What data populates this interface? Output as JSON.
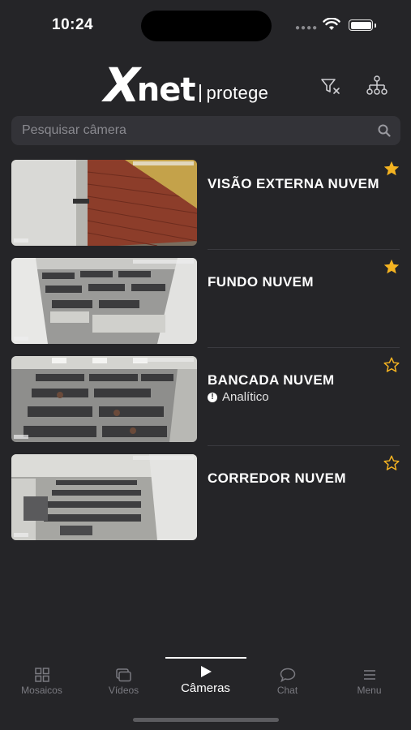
{
  "status_bar": {
    "time": "10:24"
  },
  "header": {
    "logo_x": "X",
    "logo_net": "net",
    "logo_tagline": "protege",
    "filter_icon": "filter-clear-icon",
    "tree_icon": "network-tree-icon"
  },
  "search": {
    "placeholder": "Pesquisar câmera",
    "value": ""
  },
  "cameras": [
    {
      "name": "VISÃO EXTERNA NUVEM",
      "favorite": true,
      "badge": ""
    },
    {
      "name": "FUNDO NUVEM",
      "favorite": true,
      "badge": ""
    },
    {
      "name": "BANCADA NUVEM",
      "favorite": false,
      "badge": "Analítico"
    },
    {
      "name": "CORREDOR NUVEM",
      "favorite": false,
      "badge": ""
    }
  ],
  "tabs": [
    {
      "label": "Mosaicos",
      "icon": "grid-icon",
      "active": false
    },
    {
      "label": "Vídeos",
      "icon": "video-stack-icon",
      "active": false
    },
    {
      "label": "Câmeras",
      "icon": "play-icon",
      "active": true
    },
    {
      "label": "Chat",
      "icon": "chat-bubble-icon",
      "active": false
    },
    {
      "label": "Menu",
      "icon": "hamburger-icon",
      "active": false
    }
  ],
  "colors": {
    "background": "#252528",
    "star": "#f4b321",
    "search_bg": "#333338"
  }
}
